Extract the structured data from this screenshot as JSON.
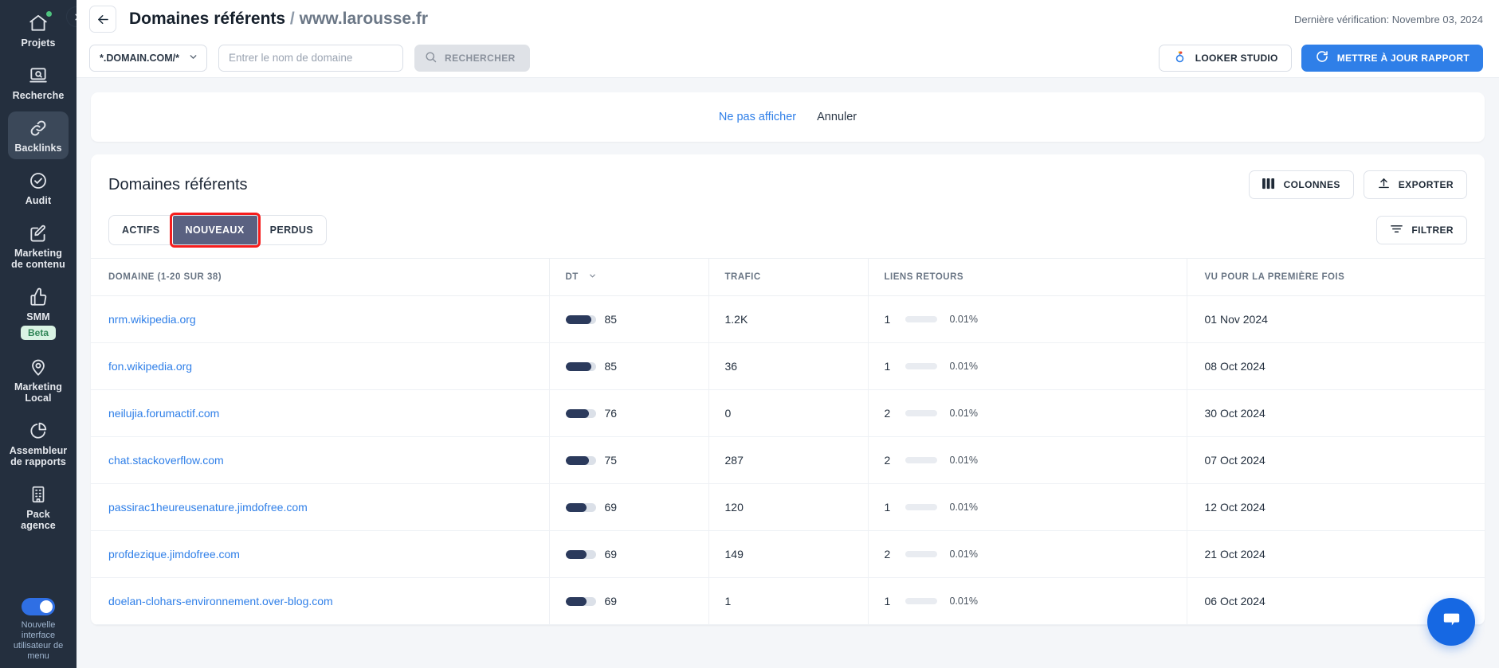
{
  "sidebar": {
    "items": [
      {
        "label": "Projets",
        "icon": "home-icon",
        "active": false,
        "badge_dot": true
      },
      {
        "label": "Recherche",
        "icon": "search-screen-icon",
        "active": false
      },
      {
        "label": "Backlinks",
        "icon": "link-icon",
        "active": true
      },
      {
        "label": "Audit",
        "icon": "check-circle-icon",
        "active": false
      },
      {
        "label": "Marketing de contenu",
        "icon": "pencil-square-icon",
        "active": false
      },
      {
        "label": "SMM",
        "icon": "thumbs-up-icon",
        "active": false,
        "badge": "Beta"
      },
      {
        "label": "Marketing Local",
        "icon": "map-pin-icon",
        "active": false
      },
      {
        "label": "Assembleur de rapports",
        "icon": "pie-chart-icon",
        "active": false
      },
      {
        "label": "Pack agence",
        "icon": "building-icon",
        "active": false
      }
    ],
    "toggle": {
      "label": "Nouvelle interface utilisateur de menu",
      "on": true
    },
    "collapse_icon": "chevron-right-icon"
  },
  "header": {
    "back_icon": "arrow-left-icon",
    "title": "Domaines référents",
    "separator": "/",
    "domain": "www.larousse.fr",
    "last_check": "Dernière vérification: Novembre 03, 2024"
  },
  "searchbar": {
    "scope_select": {
      "value": "*.DOMAIN.COM/*",
      "icon": "chevron-down-icon"
    },
    "domain_input": {
      "value": "",
      "placeholder": "Entrer le nom de domaine"
    },
    "search_button": {
      "label": "RECHERCHER",
      "icon": "search-icon"
    },
    "looker_button": {
      "label": "LOOKER STUDIO",
      "icon": "looker-studio-icon"
    },
    "update_button": {
      "label": "METTRE À JOUR RAPPORT",
      "icon": "refresh-icon"
    }
  },
  "notice": {
    "dismiss_label": "Ne pas afficher",
    "cancel_label": "Annuler"
  },
  "panel": {
    "title": "Domaines référents",
    "columns_button": {
      "label": "COLONNES",
      "icon": "columns-icon"
    },
    "export_button": {
      "label": "EXPORTER",
      "icon": "upload-icon"
    },
    "tabs": [
      {
        "label": "ACTIFS",
        "active": false,
        "highlighted": false
      },
      {
        "label": "NOUVEAUX",
        "active": true,
        "highlighted": true
      },
      {
        "label": "PERDUS",
        "active": false,
        "highlighted": false
      }
    ],
    "filter_button": {
      "label": "FILTRER",
      "icon": "filter-icon"
    }
  },
  "table": {
    "headers": {
      "domain": "DOMAINE (1-20 SUR 38)",
      "dt": "DT",
      "dt_sort_icon": "chevron-down-icon",
      "trafic": "TRAFIC",
      "liens": "LIENS RETOURS",
      "vu": "VU POUR LA PREMIÈRE FOIS"
    },
    "rows": [
      {
        "domain": "nrm.wikipedia.org",
        "dt": 85,
        "trafic": "1.2K",
        "liens": "1",
        "pct": "0.01%",
        "vu": "01 Nov 2024"
      },
      {
        "domain": "fon.wikipedia.org",
        "dt": 85,
        "trafic": "36",
        "liens": "1",
        "pct": "0.01%",
        "vu": "08 Oct 2024"
      },
      {
        "domain": "neilujia.forumactif.com",
        "dt": 76,
        "trafic": "0",
        "liens": "2",
        "pct": "0.01%",
        "vu": "30 Oct 2024"
      },
      {
        "domain": "chat.stackoverflow.com",
        "dt": 75,
        "trafic": "287",
        "liens": "2",
        "pct": "0.01%",
        "vu": "07 Oct 2024"
      },
      {
        "domain": "passirac1heureusenature.jimdofree.com",
        "dt": 69,
        "trafic": "120",
        "liens": "1",
        "pct": "0.01%",
        "vu": "12 Oct 2024"
      },
      {
        "domain": "profdezique.jimdofree.com",
        "dt": 69,
        "trafic": "149",
        "liens": "2",
        "pct": "0.01%",
        "vu": "21 Oct 2024"
      },
      {
        "domain": "doelan-clohars-environnement.over-blog.com",
        "dt": 69,
        "trafic": "1",
        "liens": "1",
        "pct": "0.01%",
        "vu": "06 Oct 2024"
      }
    ]
  },
  "chat": {
    "icon": "chat-bubble-icon"
  },
  "colors": {
    "accent_blue": "#2f7fe8",
    "sidebar_bg": "#242f3e",
    "tab_active": "#5a6181",
    "highlight_red": "#f51d1d",
    "dt_bar": "#2b3a5c",
    "beta_green": "#2f8556"
  }
}
